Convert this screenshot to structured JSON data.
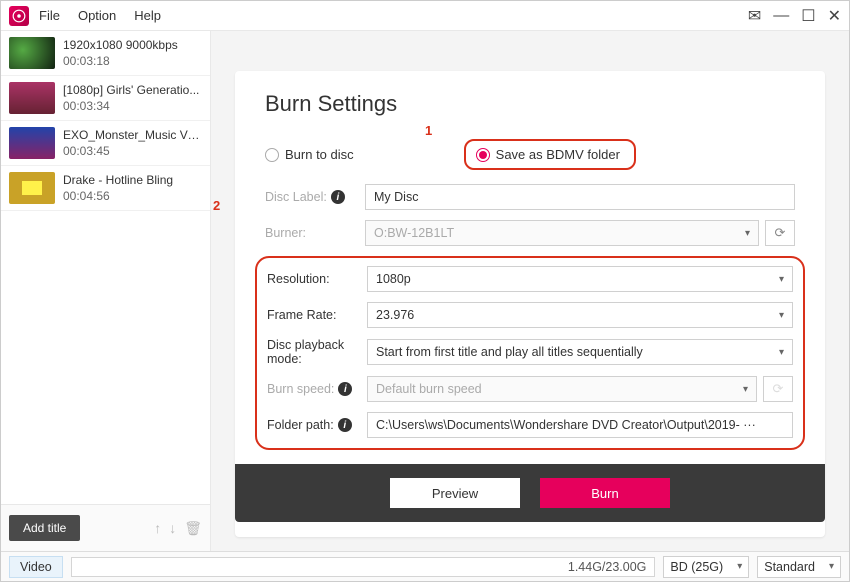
{
  "menu": {
    "file": "File",
    "option": "Option",
    "help": "Help"
  },
  "sidebar": {
    "clips": [
      {
        "title": "1920x1080 9000kbps",
        "duration": "00:03:18"
      },
      {
        "title": "[1080p] Girls' Generatio...",
        "duration": "00:03:34"
      },
      {
        "title": "EXO_Monster_Music Video",
        "duration": "00:03:45"
      },
      {
        "title": "Drake - Hotline Bling",
        "duration": "00:04:56"
      }
    ],
    "add_title": "Add title"
  },
  "panel": {
    "title": "Burn Settings",
    "radio_burn": "Burn to disc",
    "radio_bdmv": "Save as BDMV folder",
    "callout1": "1",
    "callout2": "2",
    "rows": {
      "disc_label_label": "Disc Label:",
      "disc_label_value": "My Disc",
      "burner_label": "Burner:",
      "burner_value": "O:BW-12B1LT",
      "resolution_label": "Resolution:",
      "resolution_value": "1080p",
      "framerate_label": "Frame Rate:",
      "framerate_value": "23.976",
      "playback_label": "Disc playback mode:",
      "playback_value": "Start from first title and play all titles sequentially",
      "burnspeed_label": "Burn speed:",
      "burnspeed_value": "Default burn speed",
      "folder_label": "Folder path:",
      "folder_value": "C:\\Users\\ws\\Documents\\Wondershare DVD Creator\\Output\\2019-  ···"
    },
    "preview": "Preview",
    "burn": "Burn"
  },
  "status": {
    "video": "Video",
    "size": "1.44G/23.00G",
    "disc_type": "BD (25G)",
    "quality": "Standard"
  }
}
